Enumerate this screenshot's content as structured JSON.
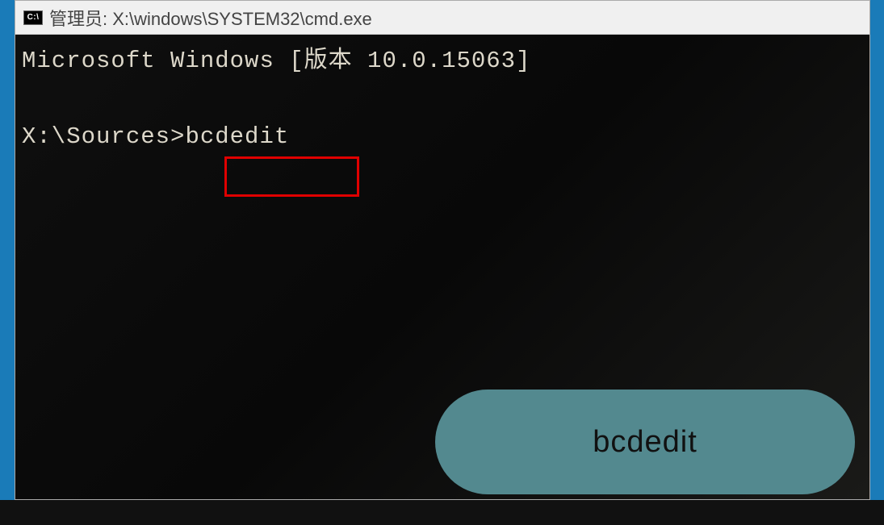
{
  "window": {
    "icon_label": "C:\\",
    "title": "管理员: X:\\windows\\SYSTEM32\\cmd.exe"
  },
  "terminal": {
    "version_line": "Microsoft Windows [版本 10.0.15063]",
    "prompt": "X:\\Sources>",
    "command": "bcdedit"
  },
  "annotation": {
    "label": "bcdedit"
  }
}
